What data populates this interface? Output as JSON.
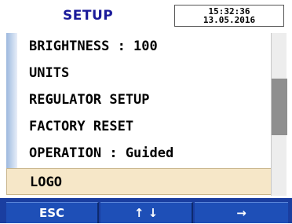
{
  "header": {
    "title": "SETUP",
    "time": "15:32:36",
    "date": "13.05.2016"
  },
  "menu": {
    "items": [
      {
        "label": "BRIGHTNESS : 100"
      },
      {
        "label": "UNITS"
      },
      {
        "label": "REGULATOR SETUP"
      },
      {
        "label": "FACTORY RESET"
      },
      {
        "label": "OPERATION : Guided"
      },
      {
        "label": "LOGO",
        "selected": true
      }
    ]
  },
  "softkeys": {
    "esc": "ESC",
    "updown": "↑ ↓",
    "enter": "→"
  },
  "colors": {
    "title": "#1a1a9a",
    "selected_bg": "#f6e7c8",
    "softkey_bg": "#1e4fb7",
    "rail": "#9db8de"
  }
}
